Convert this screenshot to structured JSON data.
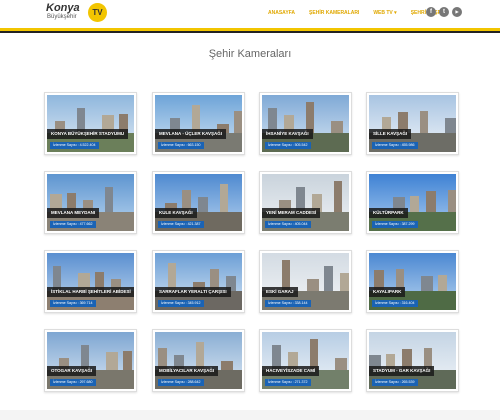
{
  "header": {
    "logo_line1": "Konya",
    "logo_line2": "Büyükşehir",
    "logo_tv": "TV",
    "nav": [
      "ANASAYFA",
      "ŞEHİR KAMERALARI",
      "WEB TV",
      "ŞEHRİ KEŞFET"
    ],
    "social": [
      {
        "icon": "facebook-icon",
        "glyph": "f"
      },
      {
        "icon": "twitter-icon",
        "glyph": "t"
      },
      {
        "icon": "youtube-icon",
        "glyph": "▶"
      }
    ],
    "accent_color": "#f2c500"
  },
  "page_title": "Şehir Kameraları",
  "cameras": [
    {
      "title": "KONYA BÜYÜKŞEHİR STADYUMU",
      "views": "İzlenme Sayısı : 4.522.404"
    },
    {
      "title": "MEVLANA - ÜÇLER KAVŞAĞI",
      "views": "İzlenme Sayısı : 663.150"
    },
    {
      "title": "İHSANİYE KAVŞAĞI",
      "views": "İzlenme Sayısı : 505.542"
    },
    {
      "title": "SİLLE KAVŞAĞI",
      "views": "İzlenme Sayısı : 455.986"
    },
    {
      "title": "MEVLANA MEYDANI",
      "views": "İzlenme Sayısı : 477.662"
    },
    {
      "title": "KULE KAVŞAĞI",
      "views": "İzlenme Sayısı : 421.387"
    },
    {
      "title": "YENİ MERAM CADDESİ",
      "views": "İzlenme Sayısı : 405.044"
    },
    {
      "title": "KÜLTÜRPARK",
      "views": "İzlenme Sayısı : 387.299"
    },
    {
      "title": "İSTİKLAL HARBİ ŞEHİTLERİ ABİDESİ",
      "views": "İzlenme Sayısı : 369.714"
    },
    {
      "title": "SARRAFLAR YERALTI ÇARŞISI",
      "views": "İzlenme Sayısı : 345.912"
    },
    {
      "title": "ESKİ GARAJ",
      "views": "İzlenme Sayısı : 338.144"
    },
    {
      "title": "KAYALIPARK",
      "views": "İzlenme Sayısı : 316.404"
    },
    {
      "title": "OTOGAR KAVŞAĞI",
      "views": "İzlenme Sayısı : 297.680"
    },
    {
      "title": "MOBİLYACILAR KAVŞAĞI",
      "views": "İzlenme Sayısı : 288.642"
    },
    {
      "title": "HACIVEYİSZADE CAMİ",
      "views": "İzlenme Sayısı : 271.372"
    },
    {
      "title": "STADYUM - GAR KAVŞAĞI",
      "views": "İzlenme Sayısı : 265.539"
    }
  ]
}
